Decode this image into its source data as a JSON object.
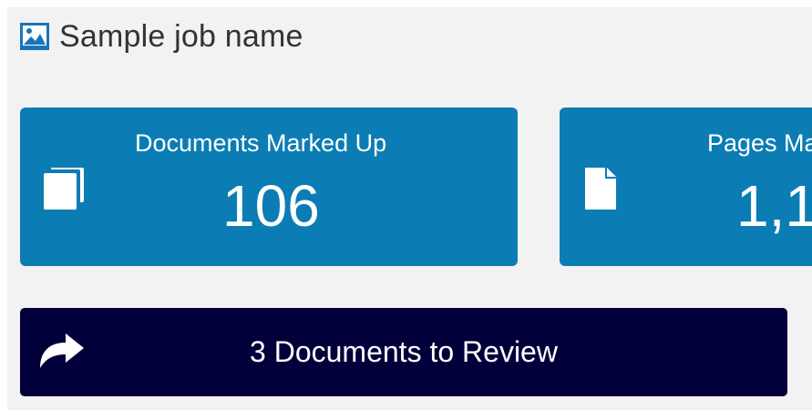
{
  "header": {
    "icon": "image-icon",
    "title": "Sample job name"
  },
  "stats": [
    {
      "icon": "documents-stack-icon",
      "label": "Documents Marked Up",
      "value": "106"
    },
    {
      "icon": "page-icon",
      "label": "Pages Ma",
      "value": "1,1"
    }
  ],
  "review": {
    "icon": "share-arrow-icon",
    "label": "3 Documents to Review"
  },
  "colors": {
    "card_blue": "#0b7db4",
    "button_navy": "#02003a",
    "panel_bg": "#f2f2f2",
    "header_icon": "#1a74b8"
  }
}
